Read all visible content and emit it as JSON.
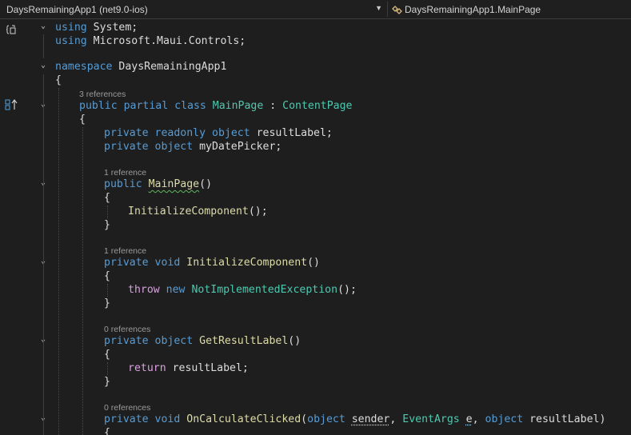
{
  "navbar": {
    "project": "DaysRemainingApp1 (net9.0-ios)",
    "member": "DaysRemainingApp1.MainPage",
    "dropdown_icon": "chevron-down-icon",
    "class_icon": "class-icon"
  },
  "code_lens": {
    "l0": "3 references",
    "l1": "1 reference",
    "l2": "1 reference",
    "l3": "0 references",
    "l4": "0 references"
  },
  "code": {
    "using": "using",
    "system": "System",
    "semi": ";",
    "microsoft_maui": "Microsoft.Maui.Controls",
    "namespace": "namespace",
    "ns_name": "DaysRemainingApp1",
    "open_brace": "{",
    "close_brace": "}",
    "public": "public",
    "partial": "partial",
    "class": "class",
    "mainpage": "MainPage",
    "colon": " : ",
    "contentpage": "ContentPage",
    "private": "private",
    "readonly": "readonly",
    "object": "object",
    "resultlabel_decl": " resultLabel;",
    "mydatepicker_decl": " myDatePicker;",
    "ctor_parens": "()",
    "initializecomponent": "InitializeComponent",
    "call_end": "();",
    "void": "void",
    "throw": "throw",
    "new": "new",
    "notimpl": "NotImplementedException",
    "getresultlabel": "GetResultLabel",
    "return": "return",
    "return_val": " resultLabel;",
    "oncalc": "OnCalculateClicked",
    "lparen": "(",
    "sender": "sender",
    "comma": ", ",
    "eventargs": "EventArgs",
    "e": "e",
    "resultlabel_param": "resultLabel",
    "rparen": ")"
  },
  "colors": {
    "keyword": "#569cd6",
    "control_keyword": "#d8a0df",
    "type": "#4ec9b0",
    "method": "#dcdcaa",
    "text": "#dcdcdc",
    "background": "#1e1e1e"
  }
}
